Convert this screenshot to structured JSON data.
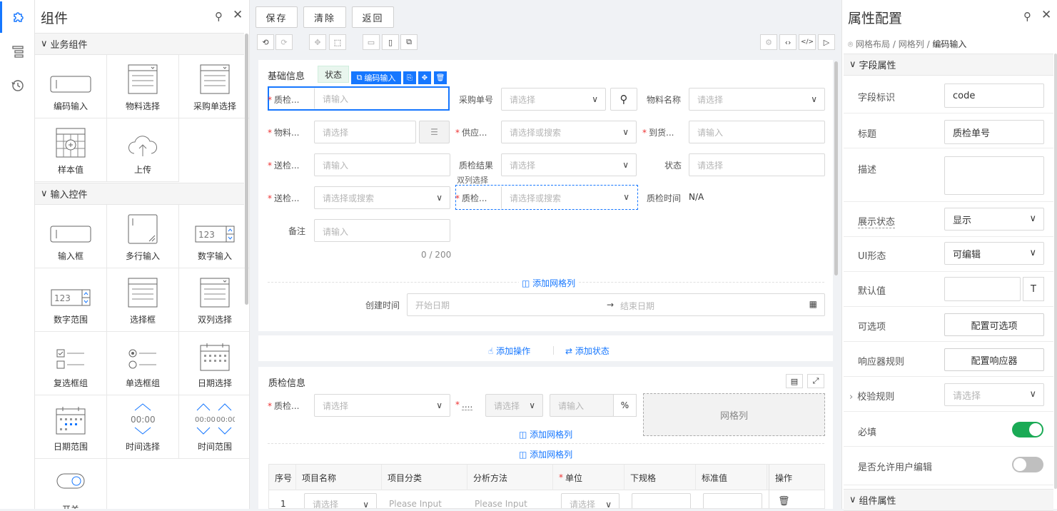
{
  "left_sidebar_icons": [
    "puzzle-icon",
    "tree-list-icon",
    "history-icon"
  ],
  "components_panel": {
    "title": "组件",
    "sections": [
      {
        "label": "业务组件",
        "items": [
          "编码输入",
          "物料选择",
          "采购单选择",
          "样本值",
          "上传"
        ]
      },
      {
        "label": "输入控件",
        "items": [
          "输入框",
          "多行输入",
          "数字输入",
          "数字范围",
          "选择框",
          "双列选择",
          "复选框组",
          "单选框组",
          "日期选择",
          "日期范围",
          "时间选择",
          "时间范围",
          "开关"
        ]
      }
    ]
  },
  "toolbar": {
    "save": "保存",
    "clear": "清除",
    "back": "返回"
  },
  "form1": {
    "title": "基础信息",
    "status_tag": "状态",
    "selected_tag": "编码输入",
    "fields": {
      "f1_label": "质检...",
      "f1_ph": "请输入",
      "f2_label": "采购单号",
      "f2_ph": "请选择",
      "f3_label": "物料名称",
      "f3_ph": "请选择",
      "f4_label": "物料...",
      "f4_ph": "请选择",
      "f5_label": "供应...",
      "f5_ph": "请选择或搜索",
      "f6_label": "到货...",
      "f6_ph": "请输入",
      "f7_label": "送检...",
      "f7_ph": "请输入",
      "f8_label": "质检结果",
      "f8_ph": "请选择",
      "f9_label": "状态",
      "f9_ph": "请选择",
      "f10_label": "送检...",
      "f10_ph": "请选择或搜索",
      "dual_hint": "双列选择",
      "f11_label": "质检...",
      "f11_ph": "请选择或搜索",
      "f12_label": "质检时间",
      "f12_value": "N/A",
      "remark_label": "备注",
      "remark_ph": "请输入",
      "remark_count": "0 / 200",
      "created_label": "创建时间",
      "start_ph": "开始日期",
      "end_ph": "结束日期"
    },
    "add_grid_col": "添加网格列",
    "add_action": "添加操作",
    "add_state": "添加状态"
  },
  "form2": {
    "title": "质检信息",
    "f1_label": "质检...",
    "f1_ph": "请选择",
    "f2_label": "....",
    "f2_ph": "请选择",
    "f3_ph": "请输入",
    "f3_unit": "%",
    "grid_placeholder": "网格列",
    "add_grid_col_1": "添加网格列",
    "add_grid_col_2": "添加网格列",
    "table": {
      "headers": [
        "序号",
        "项目名称",
        "项目分类",
        "分析方法",
        "单位",
        "下规格",
        "标准值",
        "操作"
      ],
      "row": {
        "index": "1",
        "name_ph": "请选择",
        "cat_ph": "Please Input",
        "method_ph": "Please Input",
        "unit_ph": "请选择"
      }
    }
  },
  "props_panel": {
    "title": "属性配置",
    "breadcrumb": [
      "网格布局",
      "网格列",
      "编码输入"
    ],
    "section_field": "字段属性",
    "rows": {
      "id_label": "字段标识",
      "id_value": "code",
      "title_label": "标题",
      "title_value": "质检单号",
      "desc_label": "描述",
      "display_label": "展示状态",
      "display_value": "显示",
      "ui_label": "UI形态",
      "ui_value": "可编辑",
      "default_label": "默认值",
      "options_label": "可选项",
      "options_btn": "配置可选项",
      "responder_label": "响应器规则",
      "responder_btn": "配置响应器",
      "validate_label": "校验规则",
      "validate_ph": "请选择",
      "required_label": "必填",
      "user_edit_label": "是否允许用户编辑"
    },
    "required_on": true,
    "user_edit_on": false,
    "section_component": "组件属性"
  },
  "colors": {
    "accent": "#1677ff",
    "toggle_on": "#1aaa55",
    "required": "#e33333"
  }
}
